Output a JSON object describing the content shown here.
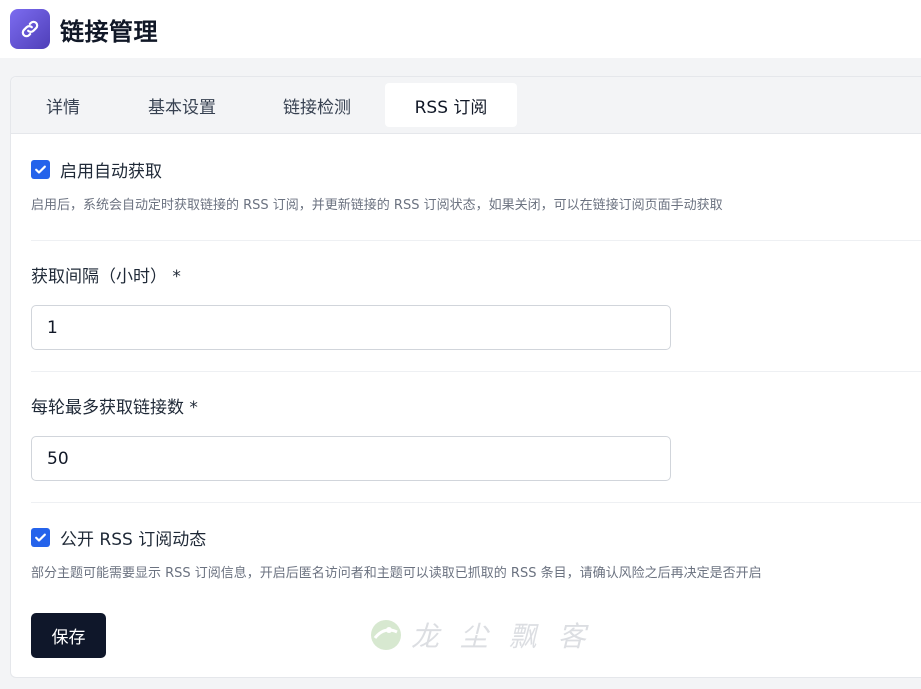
{
  "header": {
    "title": "链接管理",
    "icon": "link-icon"
  },
  "tabs": [
    {
      "label": "详情",
      "active": false
    },
    {
      "label": "基本设置",
      "active": false
    },
    {
      "label": "链接检测",
      "active": false
    },
    {
      "label": "RSS 订阅",
      "active": true
    }
  ],
  "auto_fetch": {
    "checked": true,
    "label": "启用自动获取",
    "help": "启用后，系统会自动定时获取链接的 RSS 订阅，并更新链接的 RSS 订阅状态，如果关闭，可以在链接订阅页面手动获取"
  },
  "interval": {
    "label": "获取间隔（小时） *",
    "value": "1"
  },
  "max_links": {
    "label": "每轮最多获取链接数 *",
    "value": "50"
  },
  "public_feed": {
    "checked": true,
    "label": "公开 RSS 订阅动态",
    "help": "部分主题可能需要显示 RSS 订阅信息，开启后匿名访问者和主题可以读取已抓取的 RSS 条目，请确认风险之后再决定是否开启"
  },
  "save_label": "保存",
  "watermark": "龙 尘 飘 客",
  "colors": {
    "accent": "#2563eb",
    "button": "#0f172a",
    "icon_bg": "#5b4bd1"
  }
}
